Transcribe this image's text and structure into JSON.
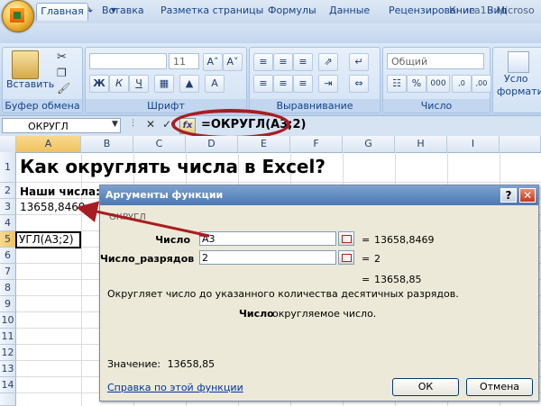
{
  "window": {
    "title": "Книга1 - Microso"
  },
  "quick_access": {
    "save_icon": "save-icon",
    "undo_icon": "undo-icon",
    "redo_icon": "redo-icon"
  },
  "tabs": [
    "Главная",
    "Вставка",
    "Разметка страницы",
    "Формулы",
    "Данные",
    "Рецензирование",
    "Вид"
  ],
  "ribbon": {
    "clipboard": {
      "paste_label": "Вставить",
      "group_label": "Буфер обмена"
    },
    "font": {
      "font_size": "11",
      "bold": "Ж",
      "italic": "К",
      "underline": "Ч",
      "group_label": "Шрифт"
    },
    "alignment": {
      "group_label": "Выравнивание"
    },
    "number": {
      "format": "Общий",
      "percent": "%",
      "thousands": "000",
      "group_label": "Число"
    },
    "styles": {
      "label_part1": "Усло",
      "label_part2": "формати"
    }
  },
  "formula_bar": {
    "name_box": "ОКРУГЛ",
    "cancel": "✕",
    "enter": "✓",
    "fx": "fx",
    "formula": "=ОКРУГЛ(A3;2)"
  },
  "columns": [
    "A",
    "B",
    "C",
    "D",
    "E",
    "F",
    "G",
    "H",
    "I"
  ],
  "rows": [
    "1",
    "2",
    "3",
    "4",
    "5",
    "6",
    "7",
    "8",
    "9",
    "10",
    "11",
    "12",
    "13",
    "14"
  ],
  "cells": {
    "A1": "Как округлять числа в Excel?",
    "A2": "Наши числа:",
    "A3": "13658,8469",
    "A5": "УГЛ(A3;2)"
  },
  "dialog": {
    "title": "Аргументы функции",
    "function_name": "ОКРУГЛ",
    "args": [
      {
        "label": "Число",
        "value": "A3",
        "result": "13658,8469"
      },
      {
        "label": "Число_разрядов",
        "value": "2",
        "result": "2"
      }
    ],
    "equals": "=",
    "formula_result": "13658,85",
    "description": "Округляет число до указанного количества десятичных разрядов.",
    "arg_desc_label": "Число",
    "arg_desc_text": "округляемое число.",
    "value_label": "Значение:",
    "value": "13658,85",
    "help_link": "Справка по этой функции",
    "ok": "ОК",
    "cancel": "Отмена",
    "help_btn": "?",
    "close_btn": "✕"
  },
  "colors": {
    "annotation": "#a81d22",
    "ribbon": "#c6d9f0",
    "dialog_title": "#4c77b4"
  }
}
